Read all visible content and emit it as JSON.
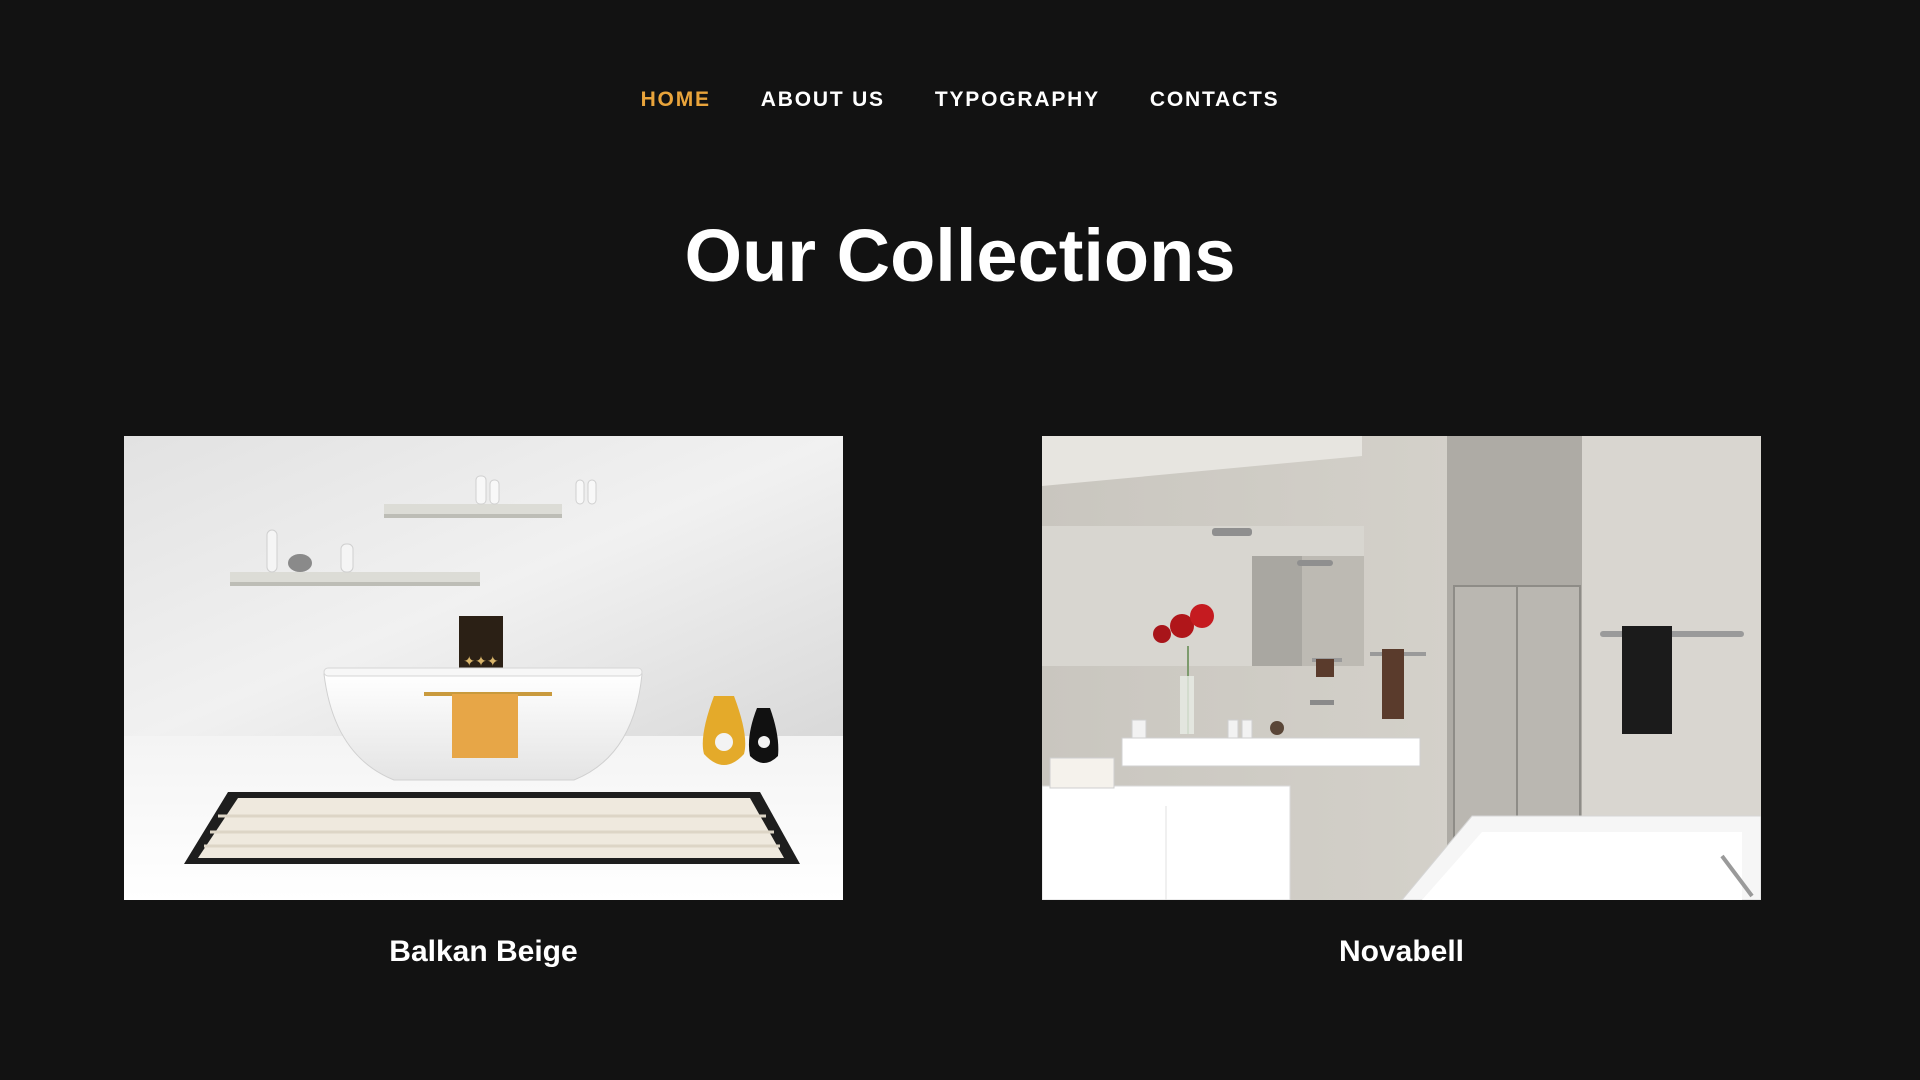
{
  "nav": {
    "items": [
      {
        "label": "HOME",
        "active": true
      },
      {
        "label": "ABOUT US",
        "active": false
      },
      {
        "label": "TYPOGRAPHY",
        "active": false
      },
      {
        "label": "CONTACTS",
        "active": false
      }
    ]
  },
  "section": {
    "title": "Our Collections"
  },
  "collections": [
    {
      "name": "Balkan Beige",
      "image": "bathroom-freestanding-tub-image"
    },
    {
      "name": "Novabell",
      "image": "bathroom-vanity-shower-image"
    }
  ],
  "colors": {
    "background": "#121212",
    "accent": "#e9a43b",
    "text": "#ffffff"
  }
}
